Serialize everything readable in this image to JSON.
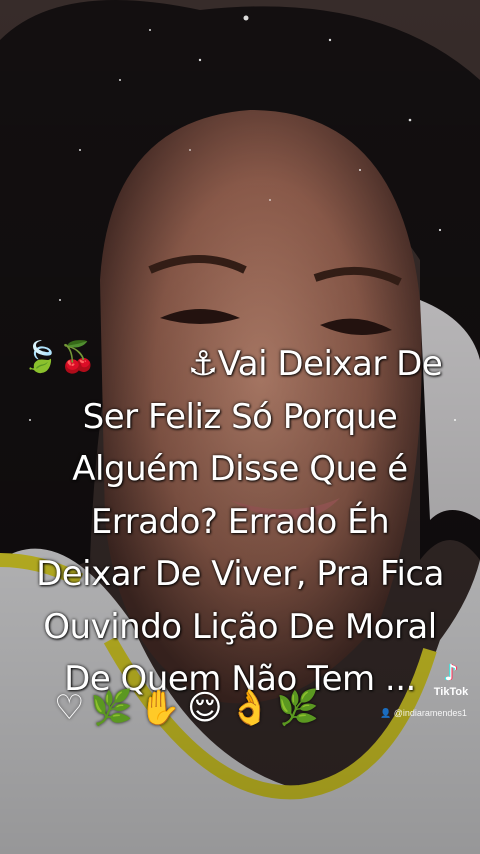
{
  "caption": {
    "lead_emoji": "🍃🍒",
    "lines": [
      "⚓Vai Deixar De",
      "Ser Feliz Só Porque",
      "Alguém Disse Que é",
      "Errado? Errado Éh",
      "Deixar De Viver, Pra Fica",
      "Ouvindo Lição De Moral",
      "De Quem Não Tem ..."
    ],
    "trailing_emoji": "♡🌿✋😌👌🌿"
  },
  "watermark": {
    "brand": "TikTok",
    "icon": "tiktok-note-icon",
    "handle": "@indiaramendes1",
    "handle_icon": "user-icon"
  }
}
